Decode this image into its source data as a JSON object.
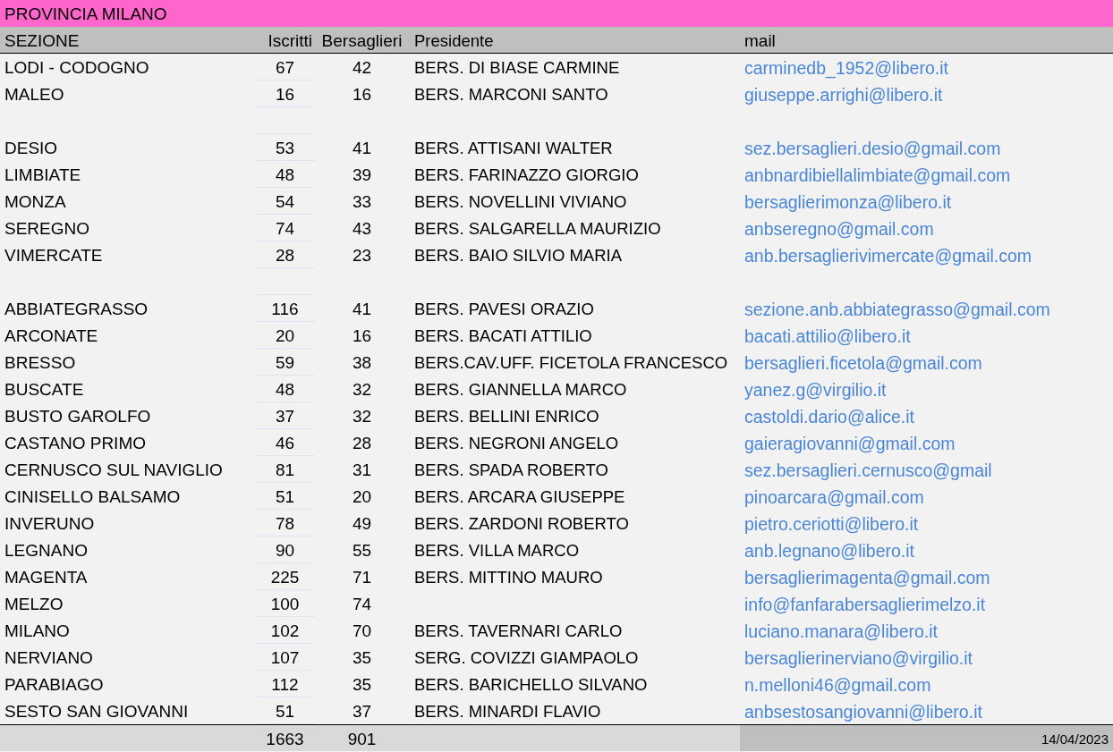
{
  "title": "PROVINCIA MILANO",
  "columns": [
    "SEZIONE",
    "Iscritti",
    "Bersaglieri",
    "Presidente",
    "mail"
  ],
  "rows": [
    {
      "kind": "data",
      "sezione": "LODI - CODOGNO",
      "iscritti": "67",
      "bersaglieri": "42",
      "presidente": "BERS. DI BIASE CARMINE",
      "mail": "carminedb_1952@libero.it"
    },
    {
      "kind": "data",
      "sezione": "MALEO",
      "iscritti": "16",
      "bersaglieri": "16",
      "presidente": "BERS. MARCONI SANTO",
      "mail": "giuseppe.arrighi@libero.it"
    },
    {
      "kind": "blank"
    },
    {
      "kind": "data",
      "sezione": "DESIO",
      "iscritti": "53",
      "bersaglieri": "41",
      "presidente": "BERS. ATTISANI WALTER",
      "mail": "sez.bersaglieri.desio@gmail.com"
    },
    {
      "kind": "data",
      "sezione": "LIMBIATE",
      "iscritti": "48",
      "bersaglieri": "39",
      "presidente": "BERS. FARINAZZO GIORGIO",
      "mail": "anbnardibiellalimbiate@gmail.com"
    },
    {
      "kind": "data",
      "sezione": "MONZA",
      "iscritti": "54",
      "bersaglieri": "33",
      "presidente": "BERS. NOVELLINI VIVIANO",
      "mail": "bersaglierimonza@libero.it"
    },
    {
      "kind": "data",
      "sezione": "SEREGNO",
      "iscritti": "74",
      "bersaglieri": "43",
      "presidente": "BERS. SALGARELLA MAURIZIO",
      "mail": "anbseregno@gmail.com"
    },
    {
      "kind": "data",
      "sezione": "VIMERCATE",
      "iscritti": "28",
      "bersaglieri": "23",
      "presidente": "BERS. BAIO SILVIO MARIA",
      "mail": "anb.bersaglierivimercate@gmail.com"
    },
    {
      "kind": "blank"
    },
    {
      "kind": "data",
      "sezione": "ABBIATEGRASSO",
      "iscritti": "116",
      "bersaglieri": "41",
      "presidente": "BERS. PAVESI ORAZIO",
      "mail": "sezione.anb.abbiategrasso@gmail.com"
    },
    {
      "kind": "data",
      "sezione": "ARCONATE",
      "iscritti": "20",
      "bersaglieri": "16",
      "presidente": "BERS. BACATI ATTILIO",
      "mail": "bacati.attilio@libero.it"
    },
    {
      "kind": "data",
      "sezione": "BRESSO",
      "iscritti": "59",
      "bersaglieri": "38",
      "presidente": "BERS.CAV.UFF. FICETOLA FRANCESCO",
      "mail": "bersaglieri.ficetola@gmail.com"
    },
    {
      "kind": "data",
      "sezione": "BUSCATE",
      "iscritti": "48",
      "bersaglieri": "32",
      "presidente": "BERS. GIANNELLA MARCO",
      "mail": "yanez.g@virgilio.it"
    },
    {
      "kind": "data",
      "sezione": "BUSTO GAROLFO",
      "iscritti": "37",
      "bersaglieri": "32",
      "presidente": "BERS. BELLINI ENRICO",
      "mail": "castoldi.dario@alice.it"
    },
    {
      "kind": "data",
      "sezione": "CASTANO PRIMO",
      "iscritti": "46",
      "bersaglieri": "28",
      "presidente": "BERS. NEGRONI ANGELO",
      "mail": "gaieragiovanni@gmail.com"
    },
    {
      "kind": "data",
      "sezione": "CERNUSCO SUL NAVIGLIO",
      "iscritti": "81",
      "bersaglieri": "31",
      "presidente": "BERS. SPADA ROBERTO",
      "mail": "sez.bersaglieri.cernusco@gmail"
    },
    {
      "kind": "data",
      "sezione": "CINISELLO BALSAMO",
      "iscritti": "51",
      "bersaglieri": "20",
      "presidente": "BERS. ARCARA GIUSEPPE",
      "mail": "pinoarcara@gmail.com"
    },
    {
      "kind": "data",
      "sezione": "INVERUNO",
      "iscritti": "78",
      "bersaglieri": "49",
      "presidente": "BERS. ZARDONI ROBERTO",
      "mail": "pietro.ceriotti@libero.it"
    },
    {
      "kind": "data",
      "sezione": "LEGNANO",
      "iscritti": "90",
      "bersaglieri": "55",
      "presidente": "BERS. VILLA MARCO",
      "mail": "anb.legnano@libero.it"
    },
    {
      "kind": "data",
      "sezione": "MAGENTA",
      "iscritti": "225",
      "bersaglieri": "71",
      "presidente": "BERS. MITTINO MAURO",
      "mail": "bersaglierimagenta@gmail.com"
    },
    {
      "kind": "data",
      "sezione": "MELZO",
      "iscritti": "100",
      "bersaglieri": "74",
      "mail": "info@fanfarabersaglierimelzo.it"
    },
    {
      "kind": "data",
      "sezione": "MILANO",
      "iscritti": "102",
      "bersaglieri": "70",
      "presidente": "BERS. TAVERNARI CARLO",
      "mail": "luciano.manara@libero.it"
    },
    {
      "kind": "data",
      "sezione": "NERVIANO",
      "iscritti": "107",
      "bersaglieri": "35",
      "presidente": "SERG. COVIZZI GIAMPAOLO",
      "mail": "bersaglierinerviano@virgilio.it"
    },
    {
      "kind": "data",
      "sezione": "PARABIAGO",
      "iscritti": "112",
      "bersaglieri": "35",
      "presidente": "BERS. BARICHELLO SILVANO",
      "mail": "n.melloni46@gmail.com"
    },
    {
      "kind": "data",
      "sezione": "SESTO SAN GIOVANNI",
      "iscritti": "51",
      "bersaglieri": "37",
      "presidente": "BERS. MINARDI FLAVIO",
      "mail": "anbsestosangiovanni@libero.it"
    }
  ],
  "totals": {
    "iscritti": "1663",
    "bersaglieri": "901",
    "date": "14/04/2023"
  }
}
